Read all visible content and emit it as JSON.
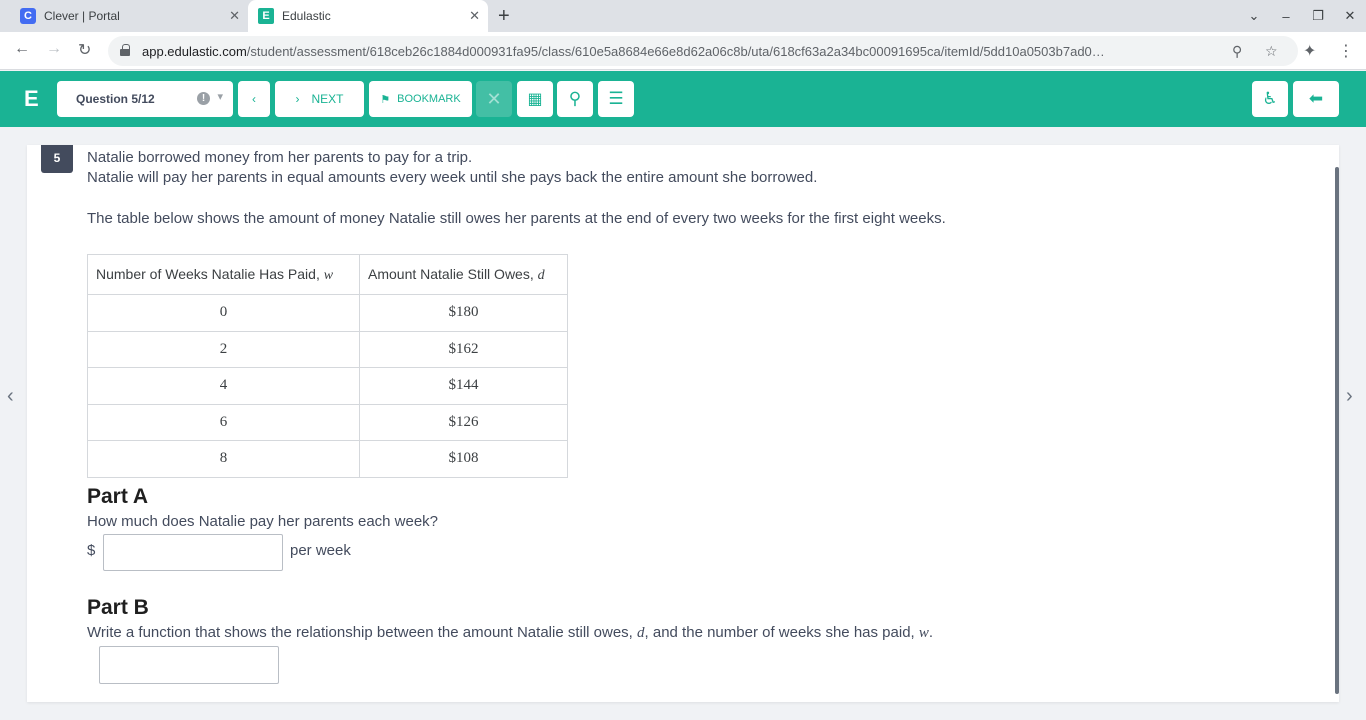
{
  "browser": {
    "tabs": [
      {
        "title": "Clever | Portal",
        "favicon": "C"
      },
      {
        "title": "Edulastic",
        "favicon": "E"
      }
    ],
    "url_host": "app.edulastic.com",
    "url_path": "/student/assessment/618ceb26c1884d000931fa95/class/610e5a8684e66e8d62a06c8b/uta/618cf63a2a34bc00091695ca/itemId/5dd10a0503b7ad0…"
  },
  "header": {
    "logo": "E",
    "question_select": "Question 5/12",
    "next_label": "NEXT",
    "bookmark_label": "BOOKMARK",
    "accent_color": "#1ab394"
  },
  "question": {
    "number": "5",
    "stem_line1": "Natalie borrowed money from her parents to pay for a trip.",
    "stem_line2": "Natalie will pay her parents in equal amounts every week until she pays back the entire amount she borrowed.",
    "stem_line3": "The table below shows the amount of money Natalie still owes her parents at the end of every two weeks for the first eight weeks.",
    "table": {
      "col1_header": "Number of Weeks Natalie Has Paid,",
      "col1_var": "w",
      "col2_header": "Amount Natalie Still Owes,",
      "col2_var": "d",
      "rows": [
        {
          "weeks": "0",
          "owes": "$180"
        },
        {
          "weeks": "2",
          "owes": "$162"
        },
        {
          "weeks": "4",
          "owes": "$144"
        },
        {
          "weeks": "6",
          "owes": "$126"
        },
        {
          "weeks": "8",
          "owes": "$108"
        }
      ]
    },
    "part_a": {
      "heading": "Part A",
      "prompt": "How much does Natalie pay her parents each week?",
      "prefix": "$",
      "suffix": "per week",
      "value": ""
    },
    "part_b": {
      "heading": "Part B",
      "prompt_pre": "Write a function that shows the relationship between the amount Natalie still owes,",
      "var_d": "d",
      "prompt_mid": ", and the number of weeks she has paid,",
      "var_w": "w",
      "prompt_end": ".",
      "value": ""
    }
  }
}
